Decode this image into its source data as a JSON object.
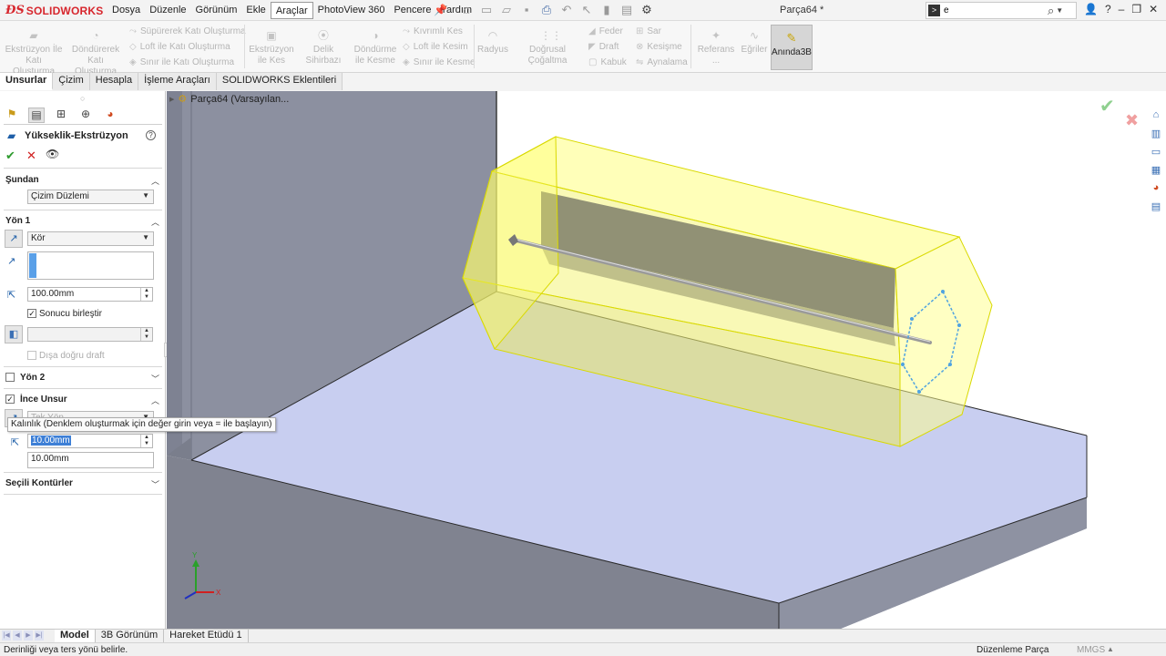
{
  "app": {
    "logo_prefix": "ƉS",
    "logo_name": "SOLIDWORKS",
    "document_title": "Parça64 *",
    "search_value": "e"
  },
  "menu": [
    {
      "label": "Dosya"
    },
    {
      "label": "Düzenle"
    },
    {
      "label": "Görünüm"
    },
    {
      "label": "Ekle"
    },
    {
      "label": "Araçlar",
      "active": true
    },
    {
      "label": "PhotoView 360"
    },
    {
      "label": "Pencere"
    },
    {
      "label": "Yardım"
    }
  ],
  "ribbon": {
    "extrude_boss": "Ekstrüzyon İle Katı Oluşturma",
    "revolve_boss": "Döndürerek Katı Oluşturma",
    "sweep_boss": "Süpürerek Katı Oluşturma",
    "loft_boss": "Loft ile Katı Oluşturma",
    "boundary_boss": "Sınır ile Katı Oluşturma",
    "extrude_cut": "Ekstrüzyon ile Kes",
    "hole_wizard": "Delik Sihirbazı",
    "revolve_cut": "Döndürme ile Kesme",
    "swept_cut": "Kıvrımlı Kes",
    "lofted_cut": "Loft ile Kesim",
    "boundary_cut": "Sınır ile Kesme",
    "fillet": "Radyus",
    "linear_pattern": "Doğrusal Çoğaltma",
    "rib": "Feder",
    "draft": "Draft",
    "shell": "Kabuk",
    "wrap": "Sar",
    "intersect": "Kesişme",
    "mirror": "Aynalama",
    "reference": "Referans ...",
    "curves": "Eğriler",
    "instant3d": "Anında3B"
  },
  "tabs": [
    {
      "label": "Unsurlar",
      "active": true
    },
    {
      "label": "Çizim"
    },
    {
      "label": "Hesapla"
    },
    {
      "label": "İşleme Araçları"
    },
    {
      "label": "SOLIDWORKS Eklentileri"
    }
  ],
  "property_manager": {
    "title": "Yükseklik-Ekstrüzyon",
    "from_section": "Şundan",
    "from_value": "Çizim Düzlemi",
    "dir1_section": "Yön 1",
    "end_condition": "Kör",
    "depth": "100.00mm",
    "merge_label": "Sonucu birleştir",
    "draft_outward_label": "Dışa doğru draft",
    "dir2_section": "Yön 2",
    "thin_section": "İnce Unsur",
    "thickness_value": "10.00mm",
    "thickness_value2": "10.00mm",
    "thin_type_partial": "Tek Yön",
    "selected_contours": "Seçili Kontürler",
    "tooltip": "Kalınlık (Denklem oluşturmak için değer girin veya = ile başlayın)"
  },
  "viewport": {
    "tree_root": "Parça64  (Varsayılan..."
  },
  "colors": {
    "preview_yellow": "#ffff66",
    "sketch_blue": "#4fa3e0",
    "plane_gray": "#8c90a0",
    "floor_blue": "#c8cef0",
    "brand_red": "#d7262d"
  },
  "bottom_tabs": [
    {
      "label": "Model",
      "active": true
    },
    {
      "label": "3B Görünüm"
    },
    {
      "label": "Hareket Etüdü 1"
    }
  ],
  "status": {
    "message": "Derinliği veya ters yönü belirle.",
    "mode": "Düzenleme Parça",
    "units": "MMGS"
  }
}
